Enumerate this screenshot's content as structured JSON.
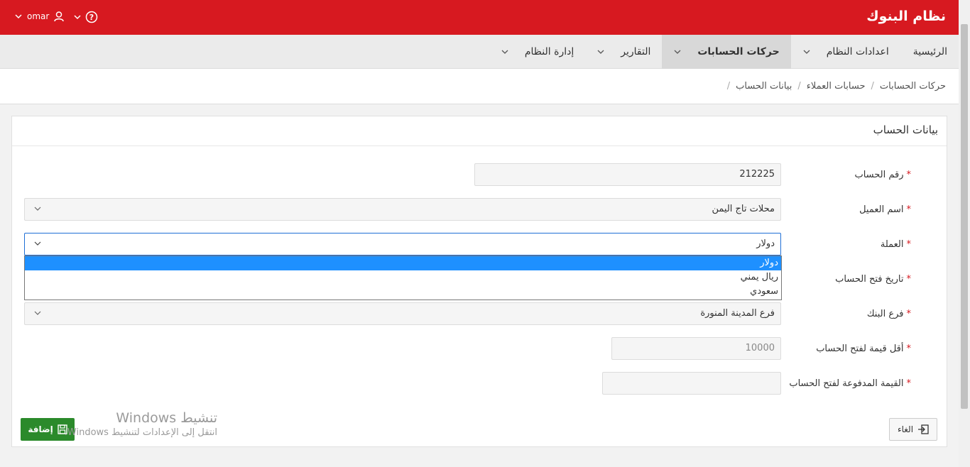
{
  "header": {
    "title": "نظام البنوك",
    "user": "omar"
  },
  "nav": [
    {
      "label": "الرئيسية",
      "dropdown": false,
      "active": false
    },
    {
      "label": "اعدادات النظام",
      "dropdown": true,
      "active": false
    },
    {
      "label": "حركات الحسابات",
      "dropdown": true,
      "active": true
    },
    {
      "label": "التقارير",
      "dropdown": true,
      "active": false
    },
    {
      "label": "إدارة النظام",
      "dropdown": true,
      "active": false
    }
  ],
  "breadcrumb": [
    "حركات الحسابات",
    "حسابات العملاء",
    "بيانات الحساب"
  ],
  "panel": {
    "title": "بيانات الحساب"
  },
  "form": {
    "account_number": {
      "label": "رقم الحساب",
      "value": "212225"
    },
    "customer_name": {
      "label": "اسم العميل",
      "value": "محلات تاج اليمن"
    },
    "currency": {
      "label": "العملة",
      "value": "دولار",
      "options": [
        "دولار",
        "ريال يمني",
        "سعودي"
      ]
    },
    "open_date": {
      "label": "تاريخ فتح الحساب"
    },
    "branch": {
      "label": "فرع البنك",
      "value": "فرع المدينة المنورة"
    },
    "min_value": {
      "label": "أقل قيمة لفتح الحساب",
      "value": "10000"
    },
    "paid_value": {
      "label": "القيمة المدفوعة لفتح الحساب",
      "value": ""
    }
  },
  "buttons": {
    "add": "إضافة",
    "cancel": "الغاء"
  },
  "watermark": {
    "line1": "تنشيط Windows",
    "line2": "انتقل إلى الإعدادات لتنشيط Windows."
  },
  "colors": {
    "brand": "#d71920",
    "add_button": "#2b8a2b",
    "focus": "#1f6fd6"
  }
}
